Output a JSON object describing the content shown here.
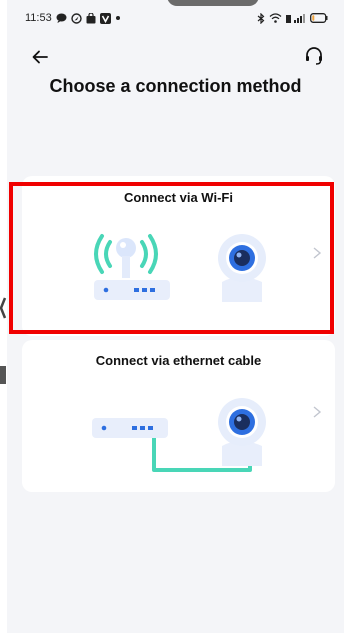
{
  "status_bar": {
    "time": "11:53",
    "left_icons": [
      "chat-icon",
      "navigation-icon",
      "bag-icon",
      "v-app-icon",
      "dot-icon"
    ],
    "right_icons": [
      "bluetooth-icon",
      "wifi-icon",
      "signal-icon",
      "battery-icon"
    ]
  },
  "header": {
    "title": "Choose a connection method"
  },
  "options": [
    {
      "label": "Connect via Wi-Fi",
      "icon": "wifi-router-icon",
      "device_icon": "camera-icon"
    },
    {
      "label": "Connect via ethernet cable",
      "icon": "ethernet-router-icon",
      "device_icon": "camera-icon"
    }
  ],
  "colors": {
    "highlight": "#f00000",
    "accent": "#2e6fe0",
    "wifi_green": "#49d6b7",
    "card_bg": "#ffffff",
    "page_bg": "#f4f5f8"
  }
}
